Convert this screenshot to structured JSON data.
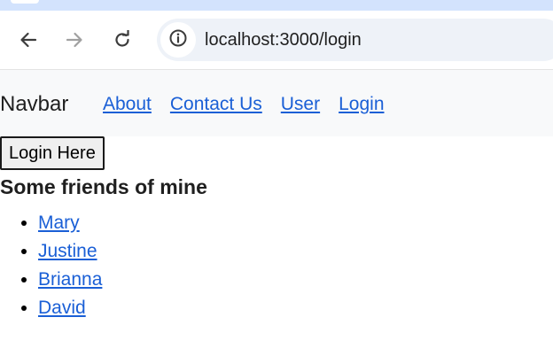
{
  "browser": {
    "url": "localhost:3000/login",
    "icons": {
      "back": "arrow-left-icon",
      "forward": "arrow-right-icon",
      "reload": "reload-icon",
      "site_info": "info-icon"
    }
  },
  "navbar": {
    "brand": "Navbar",
    "links": [
      "About",
      "Contact Us",
      "User",
      "Login"
    ]
  },
  "main": {
    "login_button": "Login Here",
    "heading": "Some friends of mine",
    "friends": [
      "Mary",
      "Justine",
      "Brianna",
      "David"
    ]
  },
  "colors": {
    "link": "#1a5fd6",
    "navbar_bg": "#f8f9fa",
    "tabstrip_bg": "#d3e3fd",
    "omnibox_bg": "#eef2f8"
  }
}
